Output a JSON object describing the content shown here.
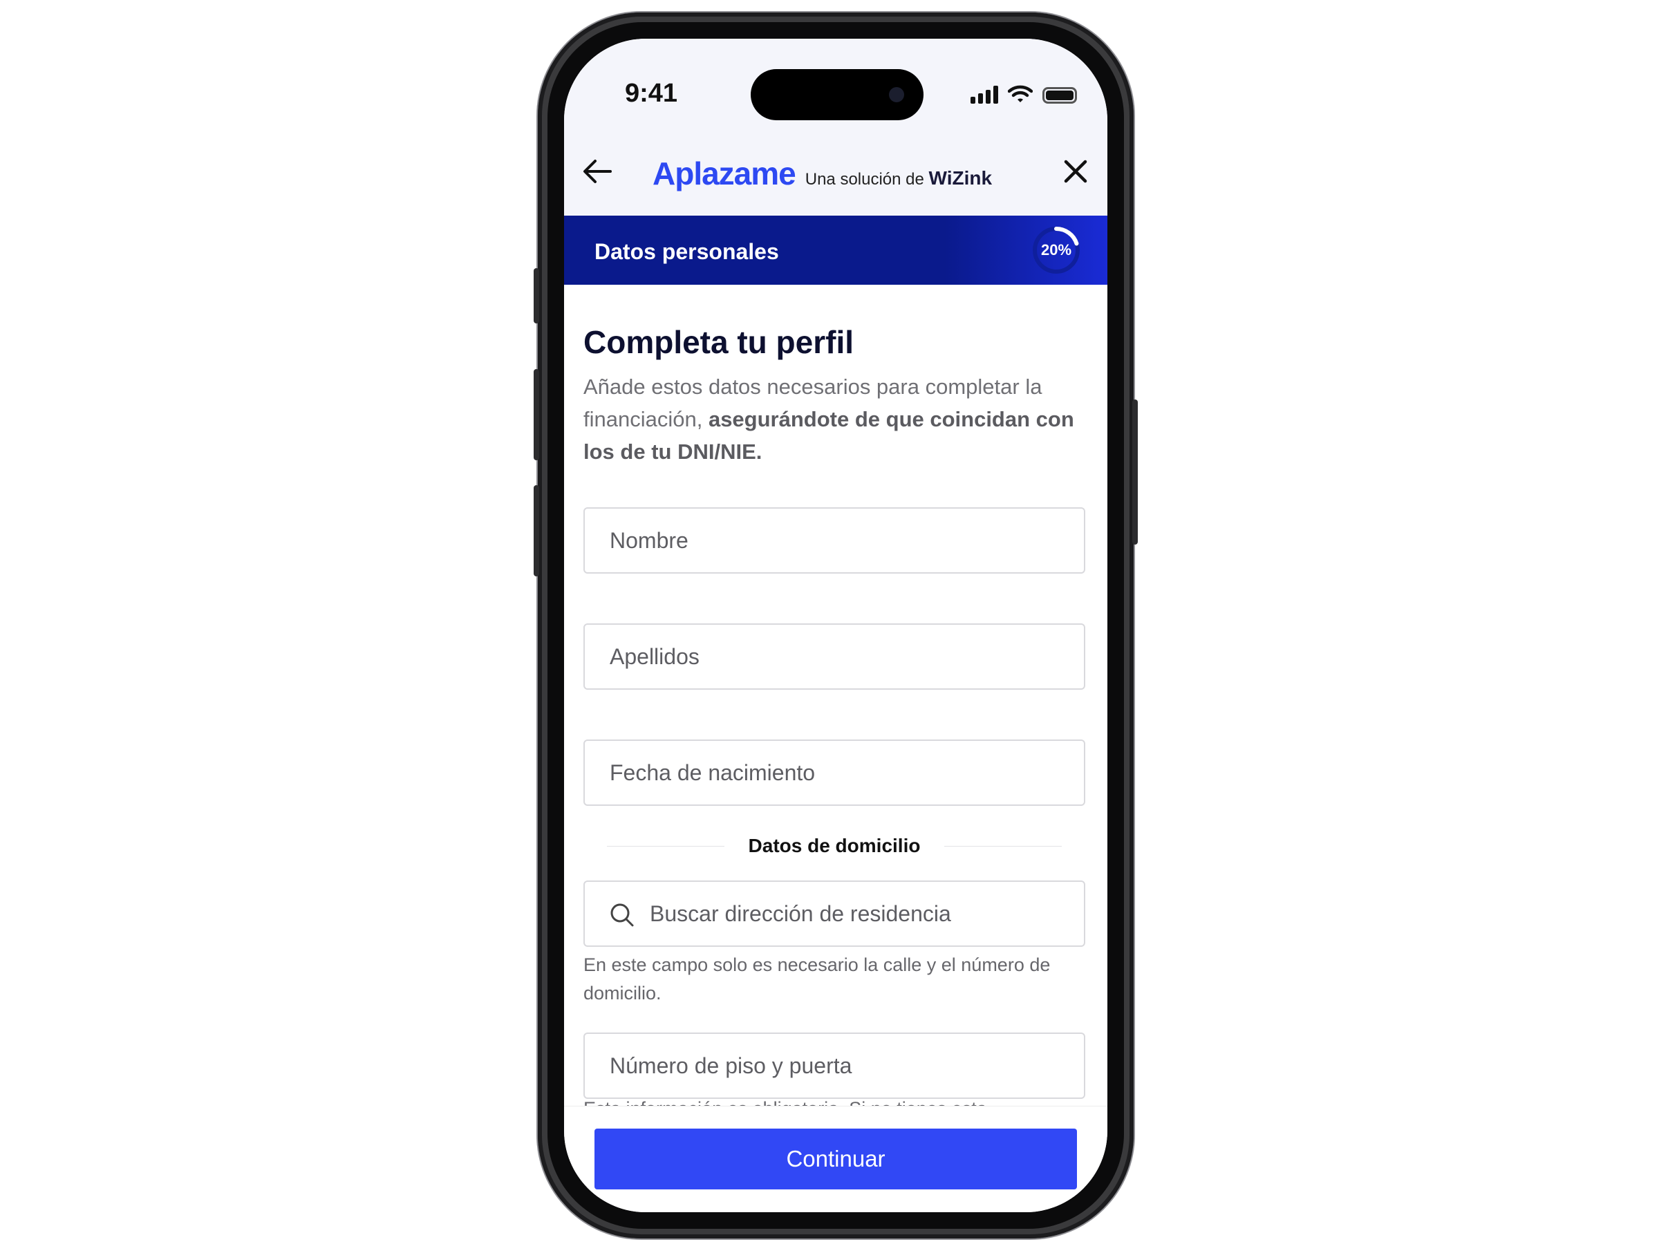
{
  "status_bar": {
    "time": "9:41",
    "icons": [
      "signal-icon",
      "wifi-icon",
      "battery-icon"
    ]
  },
  "header": {
    "back_icon": "arrow-left-icon",
    "brand_name": "Aplazame",
    "brand_tagline": "Una solución de",
    "brand_partner": "WiZink",
    "close_icon": "close-icon",
    "brand_color": "#2d49f2"
  },
  "section": {
    "title": "Datos personales",
    "progress_label": "20%",
    "progress_fraction": 0.2,
    "bar_color": "#0a1a8c"
  },
  "main": {
    "title": "Completa tu perfil",
    "description_plain": "Añade estos datos necesarios para completar la financiación, ",
    "description_bold": "asegurándote de que coincidan con los de tu DNI/NIE.",
    "fields": {
      "first_name_placeholder": "Nombre",
      "last_name_placeholder": "Apellidos",
      "birth_date_placeholder": "Fecha de nacimiento",
      "address_placeholder": "Buscar dirección de residencia",
      "floor_door_placeholder": "Número de piso y puerta"
    },
    "address_section_label": "Datos de domicilio",
    "address_helper": "En este campo solo es necesario la calle y el número de domicilio.",
    "floor_helper_partial": "Esta información es obligatoria. Si no tienes esta"
  },
  "footer": {
    "continue_label": "Continuar",
    "button_color": "#3148f5"
  }
}
